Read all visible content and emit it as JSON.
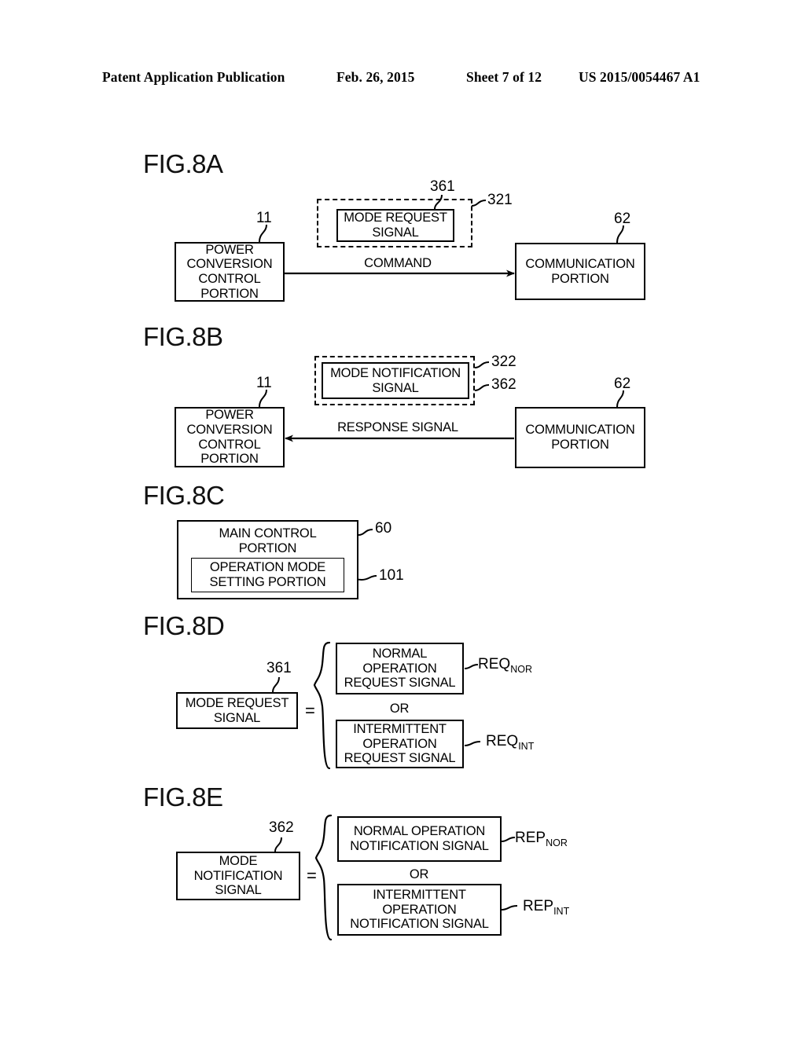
{
  "header": {
    "publication": "Patent Application Publication",
    "date": "Feb. 26, 2015",
    "sheet": "Sheet 7 of 12",
    "number": "US 2015/0054467 A1"
  },
  "figures": {
    "a": {
      "label": "FIG.8A",
      "left_box": "POWER\nCONVERSION\nCONTROL\nPORTION",
      "left_ref": "11",
      "dashed_ref": "321",
      "inner_box": "MODE REQUEST\nSIGNAL",
      "inner_ref": "361",
      "arrow_label": "COMMAND",
      "right_box": "COMMUNICATION\nPORTION",
      "right_ref": "62"
    },
    "b": {
      "label": "FIG.8B",
      "left_box": "POWER\nCONVERSION\nCONTROL\nPORTION",
      "left_ref": "11",
      "dashed_ref": "322",
      "inner_box": "MODE NOTIFICATION\nSIGNAL",
      "inner_ref": "362",
      "arrow_label": "RESPONSE SIGNAL",
      "right_box": "COMMUNICATION\nPORTION",
      "right_ref": "62"
    },
    "c": {
      "label": "FIG.8C",
      "outer_box": "MAIN CONTROL\nPORTION",
      "outer_ref": "60",
      "inner_box": "OPERATION MODE\nSETTING PORTION",
      "inner_ref": "101"
    },
    "d": {
      "label": "FIG.8D",
      "source_box": "MODE REQUEST\nSIGNAL",
      "source_ref": "361",
      "equals": "=",
      "or_label": "OR",
      "option1_box": "NORMAL\nOPERATION\nREQUEST SIGNAL",
      "option1_ref": "REQ",
      "option1_ref_sub": "NOR",
      "option2_box": "INTERMITTENT\nOPERATION\nREQUEST SIGNAL",
      "option2_ref": "REQ",
      "option2_ref_sub": "INT"
    },
    "e": {
      "label": "FIG.8E",
      "source_box": "MODE\nNOTIFICATION\nSIGNAL",
      "source_ref": "362",
      "equals": "=",
      "or_label": "OR",
      "option1_box": "NORMAL OPERATION\nNOTIFICATION SIGNAL",
      "option1_ref": "REP",
      "option1_ref_sub": "NOR",
      "option2_box": "INTERMITTENT\nOPERATION\nNOTIFICATION SIGNAL",
      "option2_ref": "REP",
      "option2_ref_sub": "INT"
    }
  },
  "colors": {
    "ink": "#000000",
    "paper": "#ffffff"
  }
}
